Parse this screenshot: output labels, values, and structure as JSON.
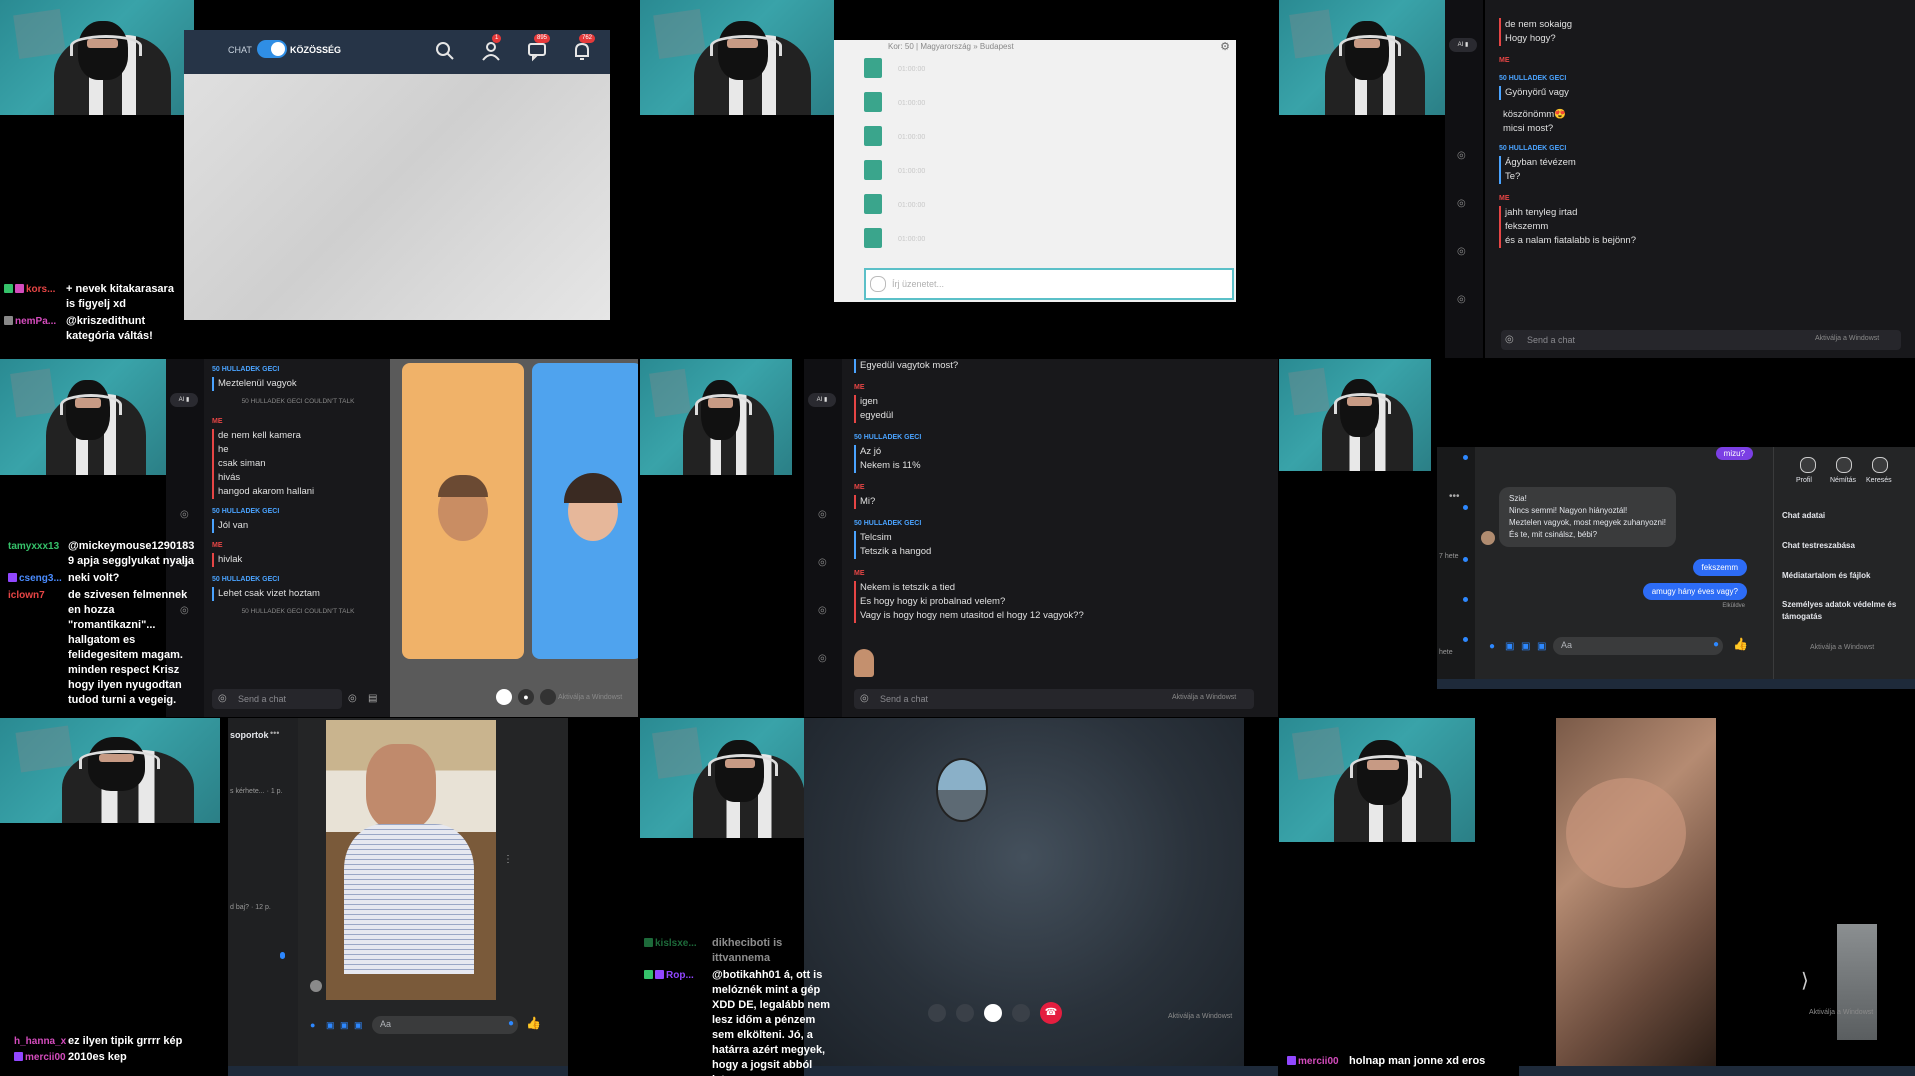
{
  "p1": {
    "toggle_left": "CHAT",
    "toggle_right": "KÖZÖSSÉG",
    "badges": [
      "1",
      "895",
      "762"
    ],
    "overlay": [
      {
        "user": "kors...",
        "text": "+ nevek kitakarasara is figyelj xd",
        "color": "#e64545"
      },
      {
        "user": "nemPa...",
        "text": "@kriszedithunt kategória váltás!",
        "color": "#d44cbd"
      }
    ]
  },
  "p2": {
    "header": "Kor: 50 | Magyarország » Budapest",
    "times": [
      "01:00:00",
      "01:00:00",
      "01:00:00",
      "01:00:00",
      "01:00:00",
      "01:00:00"
    ],
    "input_placeholder": "Írj üzenetet..."
  },
  "p3": {
    "messages": [
      {
        "who": "",
        "lines": [
          "de nem sokaigg",
          "Hogy hogy?"
        ]
      },
      {
        "who": "50 HULLADEK GECI",
        "lines": [
          "Gyönyörű vagy"
        ]
      },
      {
        "who": "ME",
        "lines": [
          "köszönömm😍",
          "micsi most?"
        ]
      },
      {
        "who": "50 HULLADEK GECI",
        "lines": [
          "Ágyban tévézem",
          "Te?"
        ]
      },
      {
        "who": "ME",
        "lines": [
          "jahh tenyleg irtad",
          "fekszemm",
          "és a nalam fiatalabb is bejönn?"
        ]
      }
    ],
    "send_placeholder": "Send a chat",
    "watermark": "Aktiválja a Windowst"
  },
  "p4": {
    "messages": [
      {
        "who": "50 HULLADEK GECI",
        "lines": [
          "Meztelenül vagyok"
        ]
      },
      {
        "who": "SYS",
        "lines": [
          "50 HULLADEK GECI COULDN'T TALK"
        ]
      },
      {
        "who": "ME",
        "lines": [
          "de nem kell kamera",
          "he",
          "csak siman",
          "hivás",
          "hangod akarom hallani"
        ]
      },
      {
        "who": "50 HULLADEK GECI",
        "lines": [
          "Jól van"
        ]
      },
      {
        "who": "ME",
        "lines": [
          "hivlak"
        ]
      },
      {
        "who": "50 HULLADEK GECI",
        "lines": [
          "Lehet csak vizet hoztam"
        ]
      },
      {
        "who": "SYS",
        "lines": [
          "50 HULLADEK GECI COULDN'T TALK"
        ]
      }
    ],
    "send_placeholder": "Send a chat",
    "overlay": [
      {
        "user": "tamyxxx13",
        "text": "@mickeymouse1290183 9 apja segglyukat nyalja",
        "color": "#35c26a"
      },
      {
        "user": "cseng3...",
        "text": "neki volt?",
        "color": "#4a8cff"
      },
      {
        "user": "iclown7",
        "text": "de szivesen felmennek en hozza \"romantikazni\"... hallgatom es felidegesitem magam. minden respect Krisz hogy ilyen nyugodtan tudod turni a vegeig.",
        "color": "#e64545"
      }
    ],
    "watermark": "Aktiválja a Windowst"
  },
  "p5": {
    "messages": [
      {
        "who": "",
        "lines": [
          "Egyedül vagytok most?"
        ]
      },
      {
        "who": "ME",
        "lines": [
          "igen",
          "egyedül"
        ]
      },
      {
        "who": "50 HULLADEK GECI",
        "lines": [
          "Az jó",
          "Nekem is 11%"
        ]
      },
      {
        "who": "ME",
        "lines": [
          "Mi?"
        ]
      },
      {
        "who": "50 HULLADEK GECI",
        "lines": [
          "Telcsim",
          "Tetszik a hangod"
        ]
      },
      {
        "who": "ME",
        "lines": [
          "Nekem is tetszik a tied",
          "Es hogy hogy ki probalnad velem?",
          "Vagy is hogy hogy nem utasitod el hogy 12 vagyok??"
        ]
      }
    ],
    "send_placeholder": "Send a chat",
    "watermark": "Aktiválja a Windowst"
  },
  "p6": {
    "top_bubble": "mizu?",
    "incoming": [
      "Szia!",
      "Nincs semmi! Nagyon hiányoztál!",
      "Meztelen vagyok, most megyek zuhanyozni!",
      "És te, mit csinálsz, bébi?"
    ],
    "outgoing": [
      "fekszemm",
      "amugy hány éves vagy?"
    ],
    "sent_label": "Elküldve",
    "input_placeholder": "Aa",
    "side_labels": [
      "7 hete",
      "hete"
    ],
    "actions": [
      "Profil",
      "Némítás",
      "Keresés"
    ],
    "menu": [
      "Chat adatai",
      "Chat testreszabása",
      "Médiatartalom és fájlok",
      "Személyes adatok védelme és támogatás"
    ],
    "watermark": "Aktiválja a Windowst"
  },
  "p7": {
    "header": "soportok",
    "items": [
      "s kérhete... · 1 p.",
      "d baj? · 12 p."
    ],
    "input_placeholder": "Aa",
    "overlay": [
      {
        "user": "h_hanna_x",
        "text": "ez ilyen tipik grrrr kép",
        "color": "#d44cbd"
      },
      {
        "user": "mercii00",
        "text": "2010es kep",
        "color": "#d44cbd"
      }
    ]
  },
  "p8": {
    "watermark": "Aktiválja a Windowst",
    "overlay": [
      {
        "user": "kislsxe...",
        "text": "dikheciboti is ittvannema",
        "color": "#35c26a"
      },
      {
        "user": "Rop...",
        "text": "@botikahh01 á, ott is melóznék mint a gép XDD DE, legalább nem lesz időm a pénzem sem elkölteni. Jó, a határra azért megyek, hogy a jogsit abból leteszem",
        "color": "#9147ff"
      }
    ]
  },
  "p9": {
    "watermark": "Aktiválja a Windowst",
    "overlay": [
      {
        "user": "mercii00",
        "text": "holnap man jonne xd eros",
        "color": "#d44cbd"
      }
    ]
  }
}
